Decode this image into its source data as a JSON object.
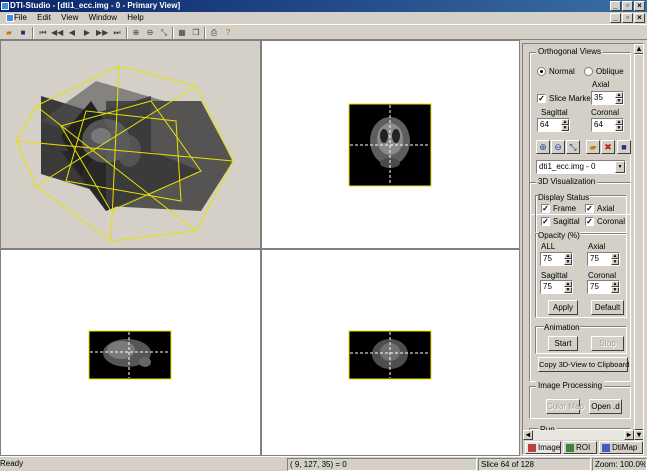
{
  "window": {
    "title": "DTI-Studio - [dti1_ecc.img - 0 - Primary View]"
  },
  "menu": [
    "File",
    "Edit",
    "View",
    "Window",
    "Help"
  ],
  "panel": {
    "ortho": {
      "label": "Orthogonal Views",
      "normal": "Normal",
      "oblique": "Oblique",
      "axial_label": "Axial",
      "slice_marker": "Slice Marker",
      "axial_value": "35",
      "sagittal_label": "Sagittal",
      "coronal_label": "Coronal",
      "sagittal_value": "64",
      "coronal_value": "64",
      "file_select": "dti1_ecc.img - 0"
    },
    "viz3d": {
      "label": "3D Visualization",
      "display_status": "Display Status",
      "frame": "Frame",
      "axial": "Axial",
      "sagittal": "Sagittal",
      "coronal": "Coronal",
      "opacity_label": "Opacity (%)",
      "all_label": "ALL",
      "axial_op_label": "Axial",
      "sagittal_op_label": "Sagittal",
      "coronal_op_label": "Coronal",
      "all_value": "75",
      "axial_op_value": "75",
      "sagittal_op_value": "75",
      "coronal_op_value": "75",
      "apply": "Apply",
      "default": "Default",
      "animation": "Animation",
      "start": "Start",
      "stop": "Stop",
      "copy": "Copy 3D-View to Clipboard"
    },
    "imgproc": {
      "label": "Image Processing",
      "color_map": "Color Map",
      "open_d": "Open .d",
      "run": "Run"
    },
    "tabs": [
      "Image",
      "ROI",
      "DtiMap"
    ]
  },
  "status": {
    "ready": "Ready",
    "coords": "( 9, 127, 35) = 0",
    "slice": "Slice 64 of 128",
    "zoom": "Zoom: 100.0%"
  },
  "colors": {
    "frame": "#e8e000",
    "title_bar": "#0a246a",
    "viewport_bg": "#ffffff",
    "render_bg": "#d4d0c8"
  }
}
